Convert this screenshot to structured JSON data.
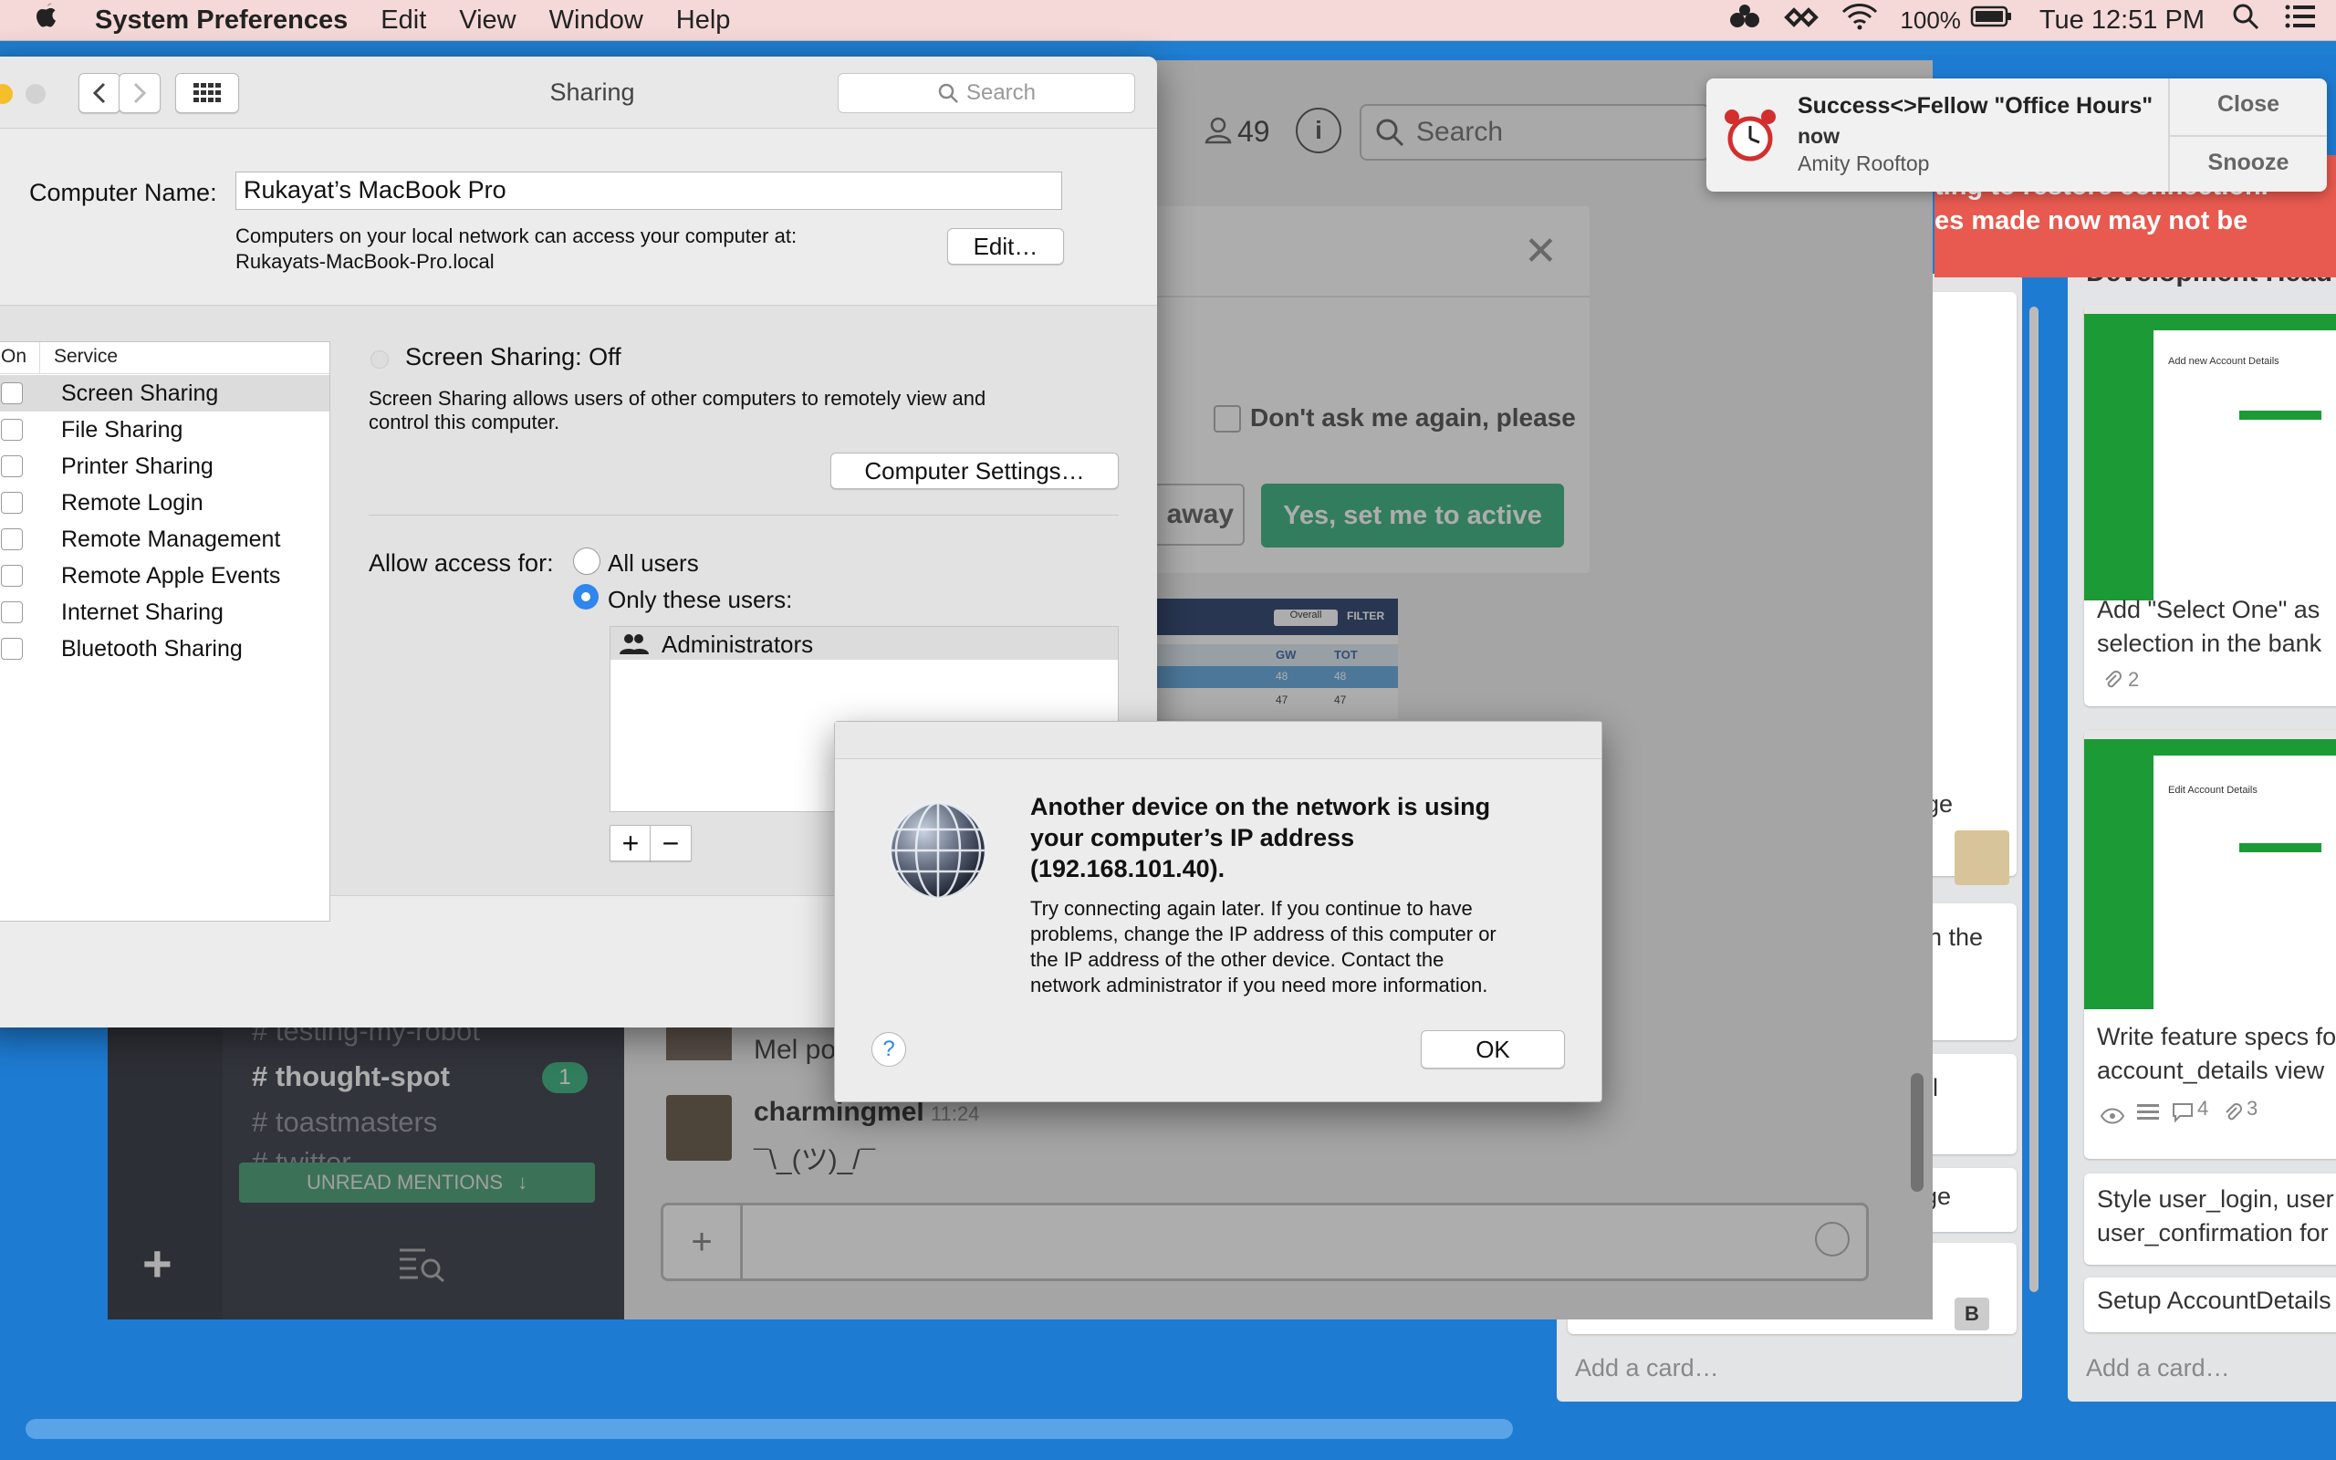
{
  "menubar": {
    "app_name": "System Preferences",
    "menus": [
      "Edit",
      "View",
      "Window",
      "Help"
    ],
    "battery": "100%",
    "clock": "Tue 12:51 PM"
  },
  "notification": {
    "title": "Success<>Fellow \"Office Hours\"",
    "time": "now",
    "location": "Amity Rooftop",
    "close_label": "Close",
    "snooze_label": "Snooze"
  },
  "slack": {
    "member_count": "49",
    "search_placeholder": "Search",
    "banner_line1": "ting to restore connection.",
    "banner_line2": "es made now may not be",
    "channels": [
      {
        "name": "testing-my-robot"
      },
      {
        "name": "thought-spot",
        "badge": "1"
      },
      {
        "name": "toastmasters"
      },
      {
        "name": "twitter"
      }
    ],
    "unread_mentions": "UNREAD MENTIONS",
    "messages": [
      {
        "author": "",
        "text": "Mel po"
      },
      {
        "author": "charmingmel",
        "time": "11:24",
        "text": "¯\\_(ツ)_/¯"
      }
    ],
    "dialog": {
      "checkbox_label": "Don't ask me again, please",
      "away_button": "away",
      "active_button": "Yes, set me to active"
    },
    "widget_filter": "FILTER",
    "widget_dropdown": "Overall",
    "widget_cols": [
      "GW",
      "TOT"
    ],
    "widget_rows": [
      [
        "48",
        "48"
      ],
      [
        "47",
        "47"
      ]
    ]
  },
  "trello": {
    "list1_fragments": [
      "ge",
      "on the",
      "l",
      "ge"
    ],
    "list1_add": "Add a card…",
    "list1_badge": "B",
    "list2_title": "Development Head",
    "list2_cards": [
      {
        "title": "Add \"Select One\" as selection in the bank",
        "meta": "2",
        "thumb_heading": "Add new Account Details"
      },
      {
        "title": "Write feature specs for account_details view",
        "meta": [
          "4",
          "3"
        ],
        "thumb_heading": "Edit Account Details"
      },
      {
        "title": "Style user_login, user user_confirmation for"
      },
      {
        "title": "Setup AccountDetails"
      }
    ],
    "list2_add": "Add a card…"
  },
  "sharing": {
    "window_title": "Sharing",
    "search_placeholder": "Search",
    "computer_name_label": "Computer Name:",
    "computer_name_value": "Rukayat’s MacBook Pro",
    "network_info_line1": "Computers on your local network can access your computer at:",
    "network_info_line2": "Rukayats-MacBook-Pro.local",
    "edit_button": "Edit…",
    "col_on": "On",
    "col_service": "Service",
    "services": [
      {
        "name": "Screen Sharing"
      },
      {
        "name": "File Sharing"
      },
      {
        "name": "Printer Sharing"
      },
      {
        "name": "Remote Login"
      },
      {
        "name": "Remote Management"
      },
      {
        "name": "Remote Apple Events"
      },
      {
        "name": "Internet Sharing"
      },
      {
        "name": "Bluetooth Sharing"
      }
    ],
    "status_title": "Screen Sharing: Off",
    "status_desc_line1": "Screen Sharing allows users of other computers to remotely view and",
    "status_desc_line2": "control this computer.",
    "computer_settings_button": "Computer Settings…",
    "allow_access_label": "Allow access for:",
    "option_all": "All users",
    "option_only": "Only these users:",
    "users": [
      "Administrators"
    ],
    "add_button": "+",
    "remove_button": "−"
  },
  "alert": {
    "heading_line1": "Another device on the network is using",
    "heading_line2": "your computer’s IP address",
    "heading_line3": "(192.168.101.40).",
    "body_line1": "Try connecting again later. If you continue to have",
    "body_line2": "problems, change the IP address of this computer or",
    "body_line3": "the IP address of the other device. Contact the",
    "body_line4": "network administrator if you need more information.",
    "help_label": "?",
    "ok_button": "OK"
  }
}
